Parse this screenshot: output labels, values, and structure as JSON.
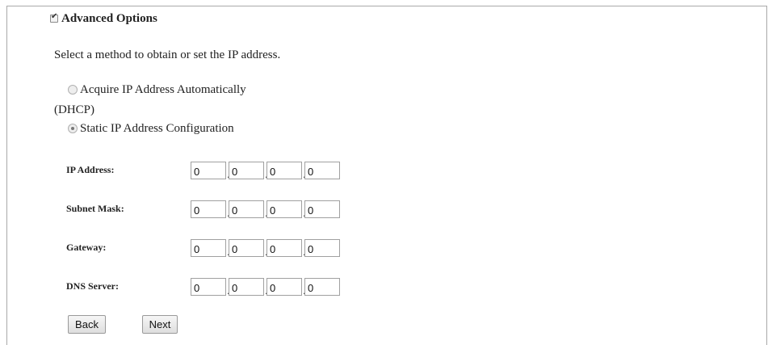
{
  "advanced_options": {
    "label": "Advanced Options",
    "checked": true
  },
  "instruction": "Select a method to obtain or set the IP address.",
  "methods": [
    {
      "label_line1": "Acquire IP Address Automatically",
      "label_line2": "(DHCP)",
      "selected": false
    },
    {
      "label_line1": "Static IP Address Configuration",
      "label_line2": "",
      "selected": true
    }
  ],
  "fields": [
    {
      "label": "IP Address:",
      "octets": [
        "0",
        "0",
        "0",
        "0"
      ]
    },
    {
      "label": "Subnet Mask:",
      "octets": [
        "0",
        "0",
        "0",
        "0"
      ]
    },
    {
      "label": "Gateway:",
      "octets": [
        "0",
        "0",
        "0",
        "0"
      ]
    },
    {
      "label": "DNS Server:",
      "octets": [
        "0",
        "0",
        "0",
        "0"
      ]
    }
  ],
  "separator": ".",
  "buttons": {
    "back": "Back",
    "next": "Next"
  }
}
